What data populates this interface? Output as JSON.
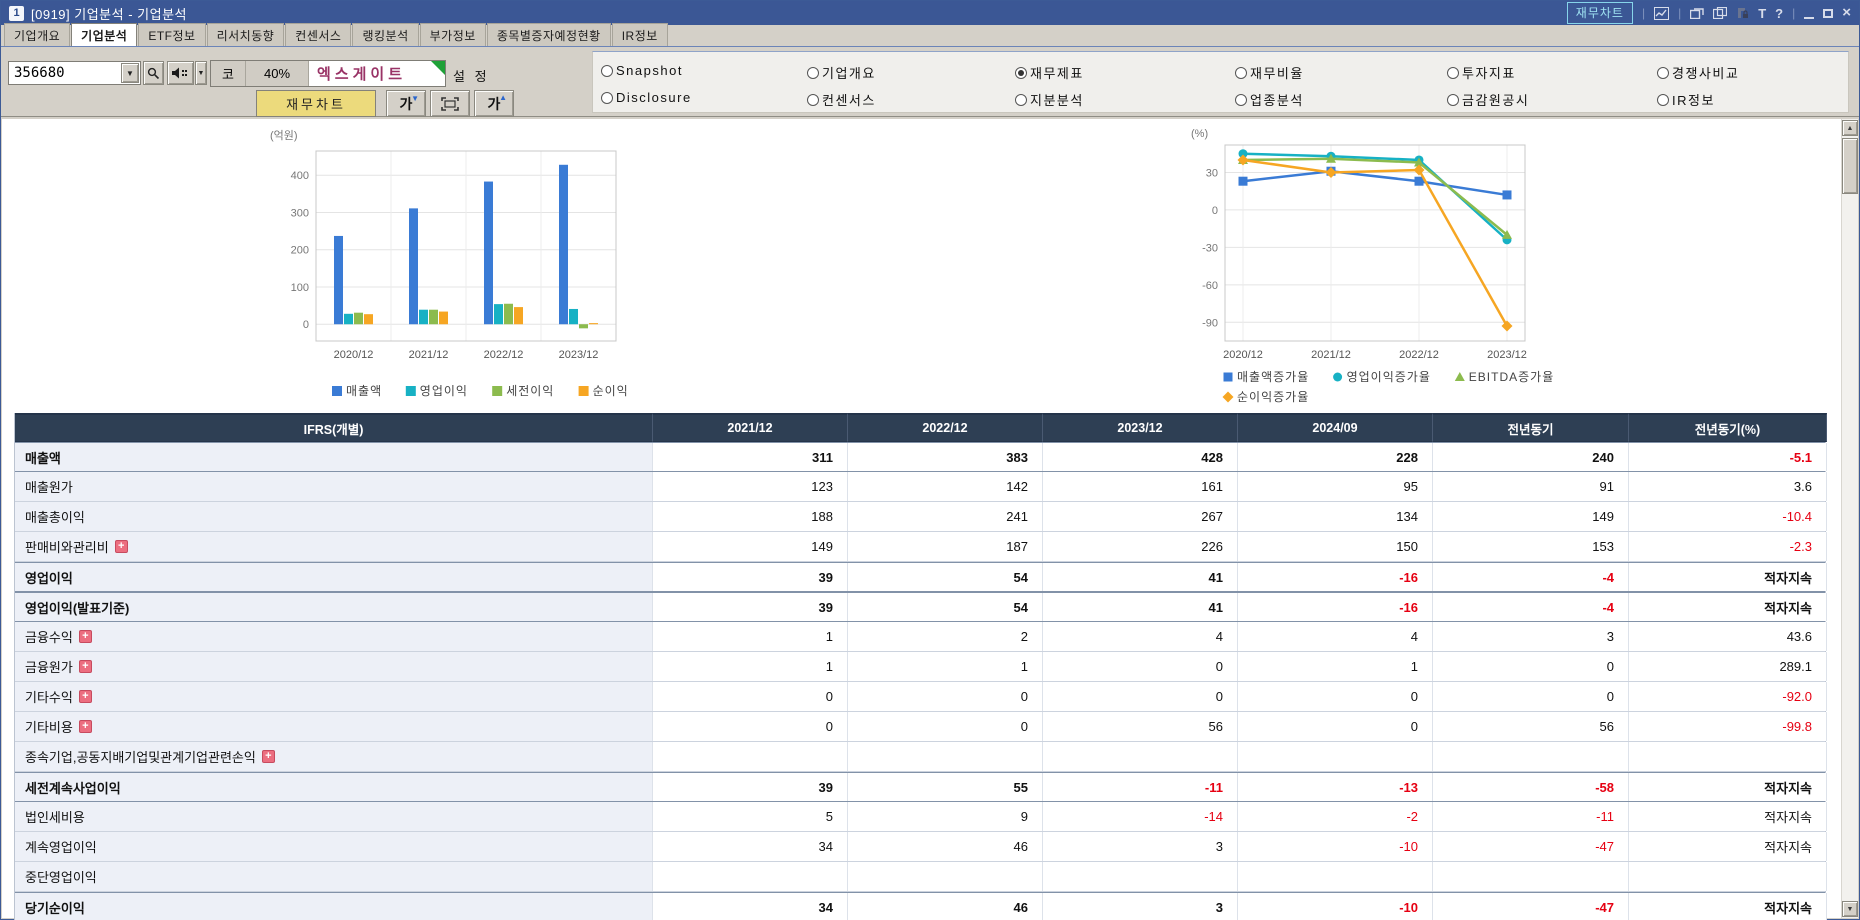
{
  "titlebar": {
    "app_badge": "1",
    "title": "[0919] 기업분석 - 기업분석",
    "fin_chart_link": "재무차트"
  },
  "tabs": {
    "active_index": 1,
    "items": [
      "기업개요",
      "기업분석",
      "ETF정보",
      "리서치동향",
      "컨센서스",
      "랭킹분석",
      "부가정보",
      "종목별증자예정현황",
      "IR정보"
    ]
  },
  "toolbar": {
    "stock_code": "356680",
    "market_badge": "코",
    "percent_badge": "40%",
    "stock_name": "엑스게이트",
    "settings_label": "설 정",
    "fin_chart_button": "재무차트",
    "font_down_label": "가",
    "font_up_label": "가"
  },
  "nav_options": {
    "rows": [
      [
        {
          "label": "Snapshot",
          "selected": false
        },
        {
          "label": "기업개요",
          "selected": false
        },
        {
          "label": "재무제표",
          "selected": true
        },
        {
          "label": "재무비율",
          "selected": false
        },
        {
          "label": "투자지표",
          "selected": false
        },
        {
          "label": "경쟁사비교",
          "selected": false
        }
      ],
      [
        {
          "label": "Disclosure",
          "selected": false
        },
        {
          "label": "컨센서스",
          "selected": false
        },
        {
          "label": "지분분석",
          "selected": false
        },
        {
          "label": "업종분석",
          "selected": false
        },
        {
          "label": "금감원공시",
          "selected": false
        },
        {
          "label": "IR정보",
          "selected": false
        }
      ]
    ]
  },
  "colors": {
    "titlebar": "#3b5795",
    "table_header": "#2e3f54",
    "negative_value": "#e60012",
    "stock_name": "#993366",
    "yellow_button": "#ecda7c",
    "series_blue": "#3a7bd5",
    "series_teal": "#17b1c4",
    "series_green": "#8cbb4e",
    "series_orange": "#f6a623"
  },
  "chart_data": [
    {
      "type": "bar",
      "unit_label": "(억원)",
      "categories": [
        "2020/12",
        "2021/12",
        "2022/12",
        "2023/12"
      ],
      "series": [
        {
          "name": "매출액",
          "color": "#3a7bd5",
          "values": [
            237,
            311,
            383,
            428
          ]
        },
        {
          "name": "영업이익",
          "color": "#17b1c4",
          "values": [
            28,
            39,
            54,
            41
          ]
        },
        {
          "name": "세전이익",
          "color": "#8cbb4e",
          "values": [
            31,
            39,
            55,
            -11
          ]
        },
        {
          "name": "순이익",
          "color": "#f6a623",
          "values": [
            27,
            34,
            46,
            3
          ]
        }
      ],
      "yticks": [
        0,
        100,
        200,
        300,
        400
      ],
      "ylim": [
        -45,
        465
      ],
      "grid": true,
      "legend_position": "bottom"
    },
    {
      "type": "line",
      "unit_label": "(%)",
      "x": [
        "2020/12",
        "2021/12",
        "2022/12",
        "2023/12"
      ],
      "series": [
        {
          "name": "매출액증가율",
          "color": "#3a7bd5",
          "marker": "square",
          "values": [
            23,
            31,
            23,
            12
          ]
        },
        {
          "name": "영업이익증가율",
          "color": "#17b1c4",
          "marker": "circle",
          "values": [
            45,
            43,
            40,
            -24
          ]
        },
        {
          "name": "EBITDA증가율",
          "color": "#8cbb4e",
          "marker": "triangle",
          "values": [
            40,
            41,
            38,
            -20
          ]
        },
        {
          "name": "순이익증가율",
          "color": "#f6a623",
          "marker": "diamond",
          "values": [
            40,
            30,
            32,
            -93
          ]
        }
      ],
      "yticks": [
        30,
        0,
        -30,
        -60,
        -90
      ],
      "ylim": [
        -105,
        52
      ],
      "grid": true,
      "legend_position": "bottom"
    }
  ],
  "table": {
    "columns": [
      "IFRS(개별)",
      "2021/12",
      "2022/12",
      "2023/12",
      "2024/09",
      "전년동기",
      "전년동기(%)"
    ],
    "rows": [
      {
        "label": "매출액",
        "bold": true,
        "expand": false,
        "values": [
          "311",
          "383",
          "428",
          "228",
          "240",
          "-5.1"
        ]
      },
      {
        "label": "매출원가",
        "bold": false,
        "expand": false,
        "values": [
          "123",
          "142",
          "161",
          "95",
          "91",
          "3.6"
        ]
      },
      {
        "label": "매출총이익",
        "bold": false,
        "expand": false,
        "values": [
          "188",
          "241",
          "267",
          "134",
          "149",
          "-10.4"
        ]
      },
      {
        "label": "판매비와관리비",
        "bold": false,
        "expand": true,
        "values": [
          "149",
          "187",
          "226",
          "150",
          "153",
          "-2.3"
        ]
      },
      {
        "label": "영업이익",
        "bold": true,
        "expand": false,
        "values": [
          "39",
          "54",
          "41",
          "-16",
          "-4",
          "적자지속"
        ]
      },
      {
        "label": "영업이익(발표기준)",
        "bold": true,
        "expand": false,
        "values": [
          "39",
          "54",
          "41",
          "-16",
          "-4",
          "적자지속"
        ]
      },
      {
        "label": "금융수익",
        "bold": false,
        "expand": true,
        "values": [
          "1",
          "2",
          "4",
          "4",
          "3",
          "43.6"
        ]
      },
      {
        "label": "금융원가",
        "bold": false,
        "expand": true,
        "values": [
          "1",
          "1",
          "0",
          "1",
          "0",
          "289.1"
        ]
      },
      {
        "label": "기타수익",
        "bold": false,
        "expand": true,
        "values": [
          "0",
          "0",
          "0",
          "0",
          "0",
          "-92.0"
        ]
      },
      {
        "label": "기타비용",
        "bold": false,
        "expand": true,
        "values": [
          "0",
          "0",
          "56",
          "0",
          "56",
          "-99.8"
        ]
      },
      {
        "label": "종속기업,공동지배기업및관계기업관련손익",
        "bold": false,
        "expand": true,
        "values": [
          "",
          "",
          "",
          "",
          "",
          ""
        ]
      },
      {
        "label": "세전계속사업이익",
        "bold": true,
        "expand": false,
        "values": [
          "39",
          "55",
          "-11",
          "-13",
          "-58",
          "적자지속"
        ]
      },
      {
        "label": "법인세비용",
        "bold": false,
        "expand": false,
        "values": [
          "5",
          "9",
          "-14",
          "-2",
          "-11",
          "적자지속"
        ]
      },
      {
        "label": "계속영업이익",
        "bold": false,
        "expand": false,
        "values": [
          "34",
          "46",
          "3",
          "-10",
          "-47",
          "적자지속"
        ]
      },
      {
        "label": "중단영업이익",
        "bold": false,
        "expand": false,
        "values": [
          "",
          "",
          "",
          "",
          "",
          ""
        ]
      },
      {
        "label": "당기순이익",
        "bold": true,
        "expand": false,
        "values": [
          "34",
          "46",
          "3",
          "-10",
          "-47",
          "적자지속"
        ]
      }
    ]
  }
}
